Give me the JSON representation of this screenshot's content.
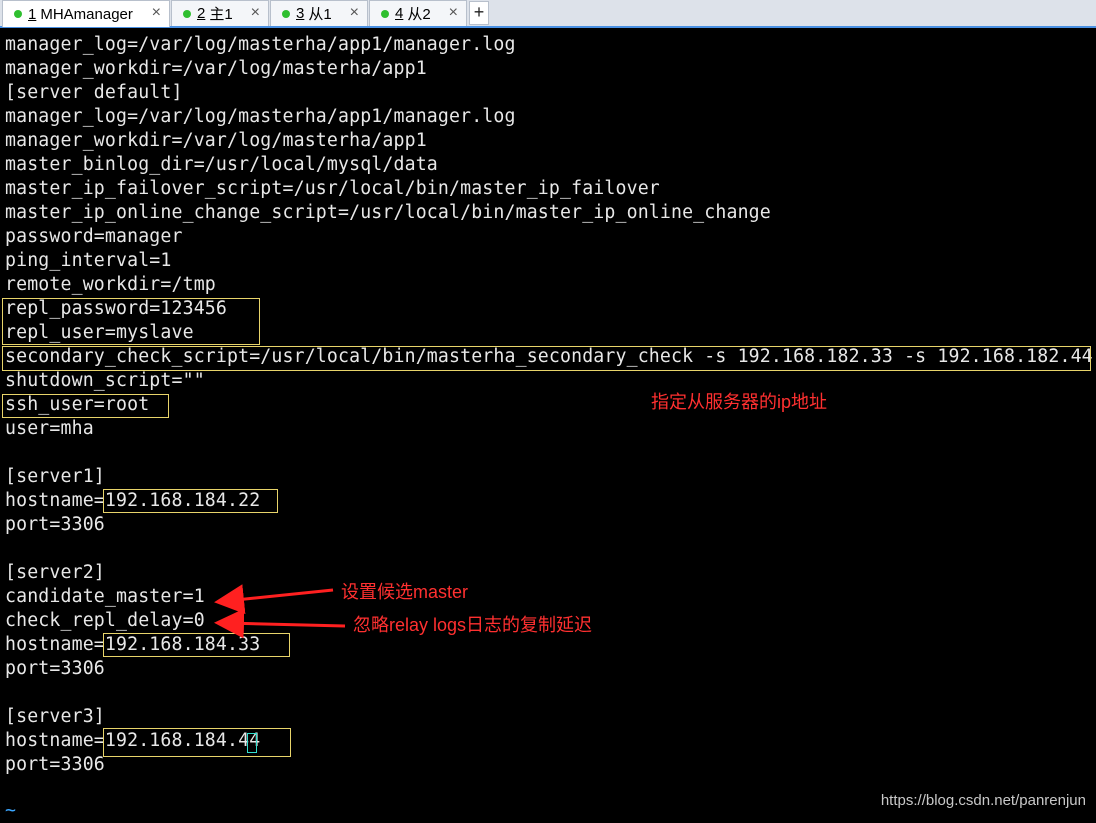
{
  "tabs": [
    {
      "num": "1",
      "label": "MHAmanager",
      "active": true
    },
    {
      "num": "2",
      "label": "主1",
      "active": false
    },
    {
      "num": "3",
      "label": "从1",
      "active": false
    },
    {
      "num": "4",
      "label": "从2",
      "active": false
    }
  ],
  "new_tab_label": "+",
  "close_glyph": "×",
  "status_color": "#2fbf2f",
  "terminal": {
    "lines": [
      "manager_log=/var/log/masterha/app1/manager.log",
      "manager_workdir=/var/log/masterha/app1",
      "[server default]",
      "manager_log=/var/log/masterha/app1/manager.log",
      "manager_workdir=/var/log/masterha/app1",
      "master_binlog_dir=/usr/local/mysql/data",
      "master_ip_failover_script=/usr/local/bin/master_ip_failover",
      "master_ip_online_change_script=/usr/local/bin/master_ip_online_change",
      "password=manager",
      "ping_interval=1",
      "remote_workdir=/tmp",
      "repl_password=123456",
      "repl_user=myslave",
      "secondary_check_script=/usr/local/bin/masterha_secondary_check -s 192.168.182.33 -s 192.168.182.44",
      "shutdown_script=\"\"",
      "ssh_user=root",
      "user=mha",
      "",
      "[server1]",
      "hostname=192.168.184.22",
      "port=3306",
      "",
      "[server2]",
      "candidate_master=1",
      "check_repl_delay=0",
      "hostname=192.168.184.33",
      "port=3306",
      "",
      "[server3]",
      "hostname=192.168.184.44",
      "port=3306",
      "",
      "~"
    ]
  },
  "annotations": {
    "slave_ip": "指定从服务器的ip地址",
    "candidate": "设置候选master",
    "ignore_delay": "忽略relay logs日志的复制延迟"
  },
  "watermark": "https://blog.csdn.net/panrenjun"
}
